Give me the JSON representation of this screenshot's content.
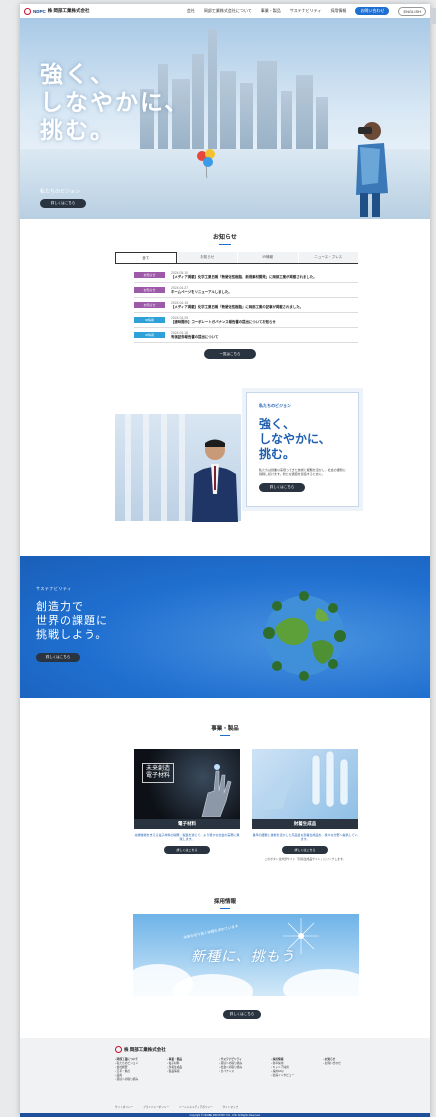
{
  "header": {
    "company_name": "株 岡部工業株式会社",
    "logo_mark": "NDPC",
    "nav": [
      "会社",
      "岡部工業株式会社について",
      "事業・製品",
      "サステナビリティ",
      "採用情報"
    ],
    "contact_label": "お問い合わせ",
    "lang_label": "ENGLISH"
  },
  "hero": {
    "headline_line1": "強く、",
    "headline_line2": "しなやかに、",
    "headline_line3": "挑む。",
    "vision_label": "私たちのビジョン",
    "button_label": "詳しくはこちら"
  },
  "news": {
    "title": "お知らせ",
    "tabs": [
      "全て",
      "お知らせ",
      "IR情報",
      "ニュース・プレス"
    ],
    "items": [
      {
        "tag": "お知らせ",
        "tag_color": "#9c5aa8",
        "date": "2024.05.10",
        "text": "【メディア掲載】化学工業日報「熱硬化性樹脂、新規素材開発」に岡部工業が掲載されました。"
      },
      {
        "tag": "お知らせ",
        "tag_color": "#9c5aa8",
        "date": "2024.04.27",
        "text": "ホームページをリニューアルしました。"
      },
      {
        "tag": "お知らせ",
        "tag_color": "#9c5aa8",
        "date": "2024.04.15",
        "text": "【メディア掲載】化学工業日報「熱硬化性樹脂」に岡部工業の記事が掲載されました。"
      },
      {
        "tag": "IR情報",
        "tag_color": "#2fa0d8",
        "date": "2024.03.29",
        "text": "【適時開示】コーポレートガバナンス報告書の提出についてお知らせ"
      },
      {
        "tag": "IR情報",
        "tag_color": "#2fa0d8",
        "date": "2024.03.18",
        "text": "有価証券報告書の提出について"
      }
    ],
    "more_label": "一覧はこちら"
  },
  "vision": {
    "eyebrow": "私たちのビジョン",
    "heading_l1": "強く、",
    "heading_l2": "しなやかに、",
    "heading_l3": "挑む。",
    "body": "私たちは創業以来培ってきた技術と経験を活かし、社会の課題に挑戦し続けます。新たな価値を創造するために。",
    "button_label": "詳しくはこちら"
  },
  "sustainability": {
    "eyebrow": "サステナビリティ",
    "heading_l1": "創造力で",
    "heading_l2": "世界の課題に",
    "heading_l3": "挑戦しよう。",
    "button_label": "詳しくはこちら"
  },
  "products": {
    "title": "事業・製品",
    "cards": [
      {
        "name": "電子材料",
        "image_text_l1": "未来創造",
        "image_text_l2": "電子材料",
        "desc": "先端技術を支える電子材料の開発・製造を通じて、より豊かな社会の実現に貢献します。",
        "button_label": "詳しくはこちら",
        "note": ""
      },
      {
        "name": "封着生成品",
        "image_text_l1": "",
        "image_text_l2": "",
        "desc": "長年の経験と技術を活かした高品質な封着生成品を、様々な分野へ提供しています。",
        "button_label": "詳しくはこちら",
        "note": "このボタンは外部サイト「封着生成品サイト」にリンクします。"
      }
    ]
  },
  "recruit": {
    "title": "採用情報",
    "image_headline": "新種に、挑もう",
    "image_sub": "未来を切り拓く仲間を求めています",
    "button_label": "詳しくはこちら"
  },
  "footer": {
    "company_name": "株 岡部工業株式会社",
    "columns": [
      {
        "head": "岡部工業について",
        "items": [
          "私たちのビジョン",
          "会社概要",
          "沿革・拠点",
          "品質",
          "環境への取り組み"
        ]
      },
      {
        "head": "事業・製品",
        "items": [
          "電子材料",
          "封着生成品",
          "製品情報"
        ]
      },
      {
        "head": "サステナビリティ",
        "items": [
          "環境への取り組み",
          "社会への取り組み",
          "ガバナンス"
        ]
      },
      {
        "head": "採用情報",
        "items": [
          "新卒採用",
          "キャリア採用",
          "採用FAQ",
          "社員インタビュー"
        ]
      },
      {
        "head": "お知らせ",
        "items": [
          "お問い合わせ"
        ]
      }
    ],
    "bottom_links": [
      "サイトポリシー",
      "プライバシーポリシー",
      "ソーシャルメディアポリシー",
      "サイトマップ"
    ],
    "copyright": "Copyright © OKABE INDUSTRY CO., LTD. All Rights Reserved."
  },
  "colors": {
    "accent": "#1f6fd0",
    "dark_button": "#2a3440",
    "news_tag": "#9c5aa8",
    "ir_tag": "#2fa0d8"
  }
}
